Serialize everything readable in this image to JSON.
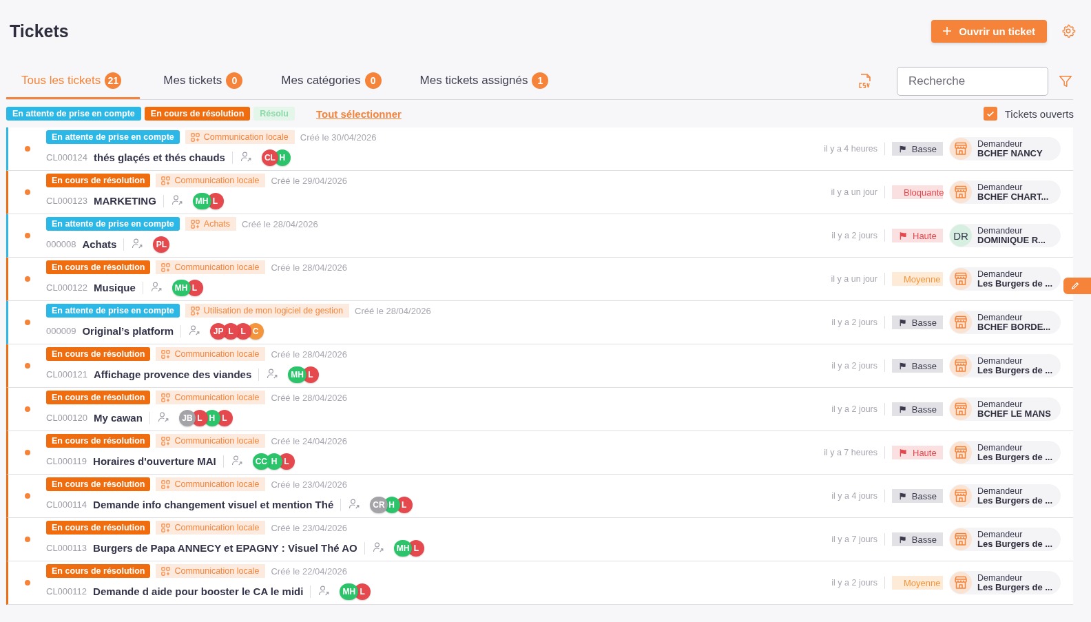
{
  "page": {
    "title": "Tickets",
    "new_button": "Ouvrir un ticket"
  },
  "tabs": [
    {
      "label": "Tous les tickets",
      "count": "21",
      "selected": true
    },
    {
      "label": "Mes tickets",
      "count": "0",
      "selected": false
    },
    {
      "label": "Mes catégories",
      "count": "0",
      "selected": false
    },
    {
      "label": "Mes tickets assignés",
      "count": "1",
      "selected": false
    }
  ],
  "search": {
    "placeholder": "Recherche"
  },
  "status_filters": [
    {
      "kind": "waiting",
      "label": "En attente de prise en compte",
      "selected": true
    },
    {
      "kind": "progress",
      "label": "En cours de résolution",
      "selected": true
    },
    {
      "kind": "resolved",
      "label": "Résolu",
      "selected": false
    }
  ],
  "select_all": "Tout sélectionner",
  "open_only": {
    "label": "Tickets ouverts",
    "checked": true
  },
  "tickets": [
    {
      "status": {
        "kind": "waiting",
        "label": "En attente de prise en compte"
      },
      "category": "Communication locale",
      "created": "Créé le 30/04/2026",
      "id": "CL000124",
      "title": "thés glaçés et thés chauds",
      "assignees": [
        {
          "initials": "CL",
          "color": "#e5484d"
        },
        {
          "initials": "H",
          "color": "#2bc46b"
        }
      ],
      "time": "il y a 4 heures",
      "priority": {
        "kind": "low",
        "label": "Basse"
      },
      "requester": {
        "kind": "store",
        "caption": "Demandeur",
        "name": "BCHEF NANCY"
      }
    },
    {
      "status": {
        "kind": "progress",
        "label": "En cours de résolution"
      },
      "category": "Communication locale",
      "created": "Créé le 29/04/2026",
      "id": "CL000123",
      "title": "MARKETING",
      "assignees": [
        {
          "initials": "MH",
          "color": "#2bc46b"
        },
        {
          "initials": "L",
          "color": "#e5484d"
        }
      ],
      "time": "il y a un jour",
      "priority": {
        "kind": "blocking",
        "label": "Bloquante"
      },
      "requester": {
        "kind": "store",
        "caption": "Demandeur",
        "name": "BCHEF CHART..."
      }
    },
    {
      "status": {
        "kind": "waiting",
        "label": "En attente de prise en compte"
      },
      "category": "Achats",
      "created": "Créé le 28/04/2026",
      "id": "000008",
      "title": "Achats",
      "assignees": [
        {
          "initials": "PL",
          "color": "#e5484d"
        }
      ],
      "time": "il y a 2 jours",
      "priority": {
        "kind": "high",
        "label": "Haute"
      },
      "requester": {
        "kind": "initials",
        "initials": "DR",
        "caption": "Demandeur",
        "name": "DOMINIQUE R..."
      }
    },
    {
      "status": {
        "kind": "progress",
        "label": "En cours de résolution"
      },
      "category": "Communication locale",
      "created": "Créé le 28/04/2026",
      "id": "CL000122",
      "title": "Musique",
      "assignees": [
        {
          "initials": "MH",
          "color": "#2bc46b"
        },
        {
          "initials": "L",
          "color": "#e5484d"
        }
      ],
      "time": "il y a un jour",
      "priority": {
        "kind": "medium",
        "label": "Moyenne"
      },
      "requester": {
        "kind": "store",
        "caption": "Demandeur",
        "name": "Les Burgers de ..."
      }
    },
    {
      "status": {
        "kind": "waiting",
        "label": "En attente de prise en compte"
      },
      "category": "Utilisation de mon logiciel de gestion",
      "created": "Créé le 28/04/2026",
      "id": "000009",
      "title": "Original’s platform",
      "assignees": [
        {
          "initials": "JP",
          "color": "#e5484d"
        },
        {
          "initials": "L",
          "color": "#e5484d"
        },
        {
          "initials": "L",
          "color": "#e5484d"
        },
        {
          "initials": "C",
          "color": "#f5953b"
        }
      ],
      "time": "il y a 2 jours",
      "priority": {
        "kind": "low",
        "label": "Basse"
      },
      "requester": {
        "kind": "store",
        "caption": "Demandeur",
        "name": "BCHEF BORDE..."
      }
    },
    {
      "status": {
        "kind": "progress",
        "label": "En cours de résolution"
      },
      "category": "Communication locale",
      "created": "Créé le 28/04/2026",
      "id": "CL000121",
      "title": "Affichage provence des viandes",
      "assignees": [
        {
          "initials": "MH",
          "color": "#2bc46b"
        },
        {
          "initials": "L",
          "color": "#e5484d"
        }
      ],
      "time": "il y a 2 jours",
      "priority": {
        "kind": "low",
        "label": "Basse"
      },
      "requester": {
        "kind": "store",
        "caption": "Demandeur",
        "name": "Les Burgers de ..."
      }
    },
    {
      "status": {
        "kind": "progress",
        "label": "En cours de résolution"
      },
      "category": "Communication locale",
      "created": "Créé le 28/04/2026",
      "id": "CL000120",
      "title": "My cawan",
      "assignees": [
        {
          "initials": "JB",
          "color": "#a3a3a8"
        },
        {
          "initials": "L",
          "color": "#e5484d"
        },
        {
          "initials": "H",
          "color": "#2bc46b"
        },
        {
          "initials": "L",
          "color": "#e5484d"
        }
      ],
      "time": "il y a 2 jours",
      "priority": {
        "kind": "low",
        "label": "Basse"
      },
      "requester": {
        "kind": "store",
        "caption": "Demandeur",
        "name": "BCHEF LE MANS"
      }
    },
    {
      "status": {
        "kind": "progress",
        "label": "En cours de résolution"
      },
      "category": "Communication locale",
      "created": "Créé le 24/04/2026",
      "id": "CL000119",
      "title": "Horaires d'ouverture MAI",
      "assignees": [
        {
          "initials": "CC",
          "color": "#2bc46b"
        },
        {
          "initials": "H",
          "color": "#2bc46b"
        },
        {
          "initials": "L",
          "color": "#e5484d"
        }
      ],
      "time": "il y a 7 heures",
      "priority": {
        "kind": "high",
        "label": "Haute"
      },
      "requester": {
        "kind": "store",
        "caption": "Demandeur",
        "name": "Les Burgers de ..."
      }
    },
    {
      "status": {
        "kind": "progress",
        "label": "En cours de résolution"
      },
      "category": "Communication locale",
      "created": "Créé le 23/04/2026",
      "id": "CL000114",
      "title": "Demande info changement visuel et mention Thé",
      "assignees": [
        {
          "initials": "CR",
          "color": "#a3a3a8"
        },
        {
          "initials": "H",
          "color": "#2bc46b"
        },
        {
          "initials": "L",
          "color": "#e5484d"
        }
      ],
      "time": "il y a 4 jours",
      "priority": {
        "kind": "low",
        "label": "Basse"
      },
      "requester": {
        "kind": "store",
        "caption": "Demandeur",
        "name": "Les Burgers de ..."
      }
    },
    {
      "status": {
        "kind": "progress",
        "label": "En cours de résolution"
      },
      "category": "Communication locale",
      "created": "Créé le 23/04/2026",
      "id": "CL000113",
      "title": "Burgers de Papa ANNECY et EPAGNY : Visuel Thé AO",
      "assignees": [
        {
          "initials": "MH",
          "color": "#2bc46b"
        },
        {
          "initials": "L",
          "color": "#e5484d"
        }
      ],
      "time": "il y a 7 jours",
      "priority": {
        "kind": "low",
        "label": "Basse"
      },
      "requester": {
        "kind": "store",
        "caption": "Demandeur",
        "name": "Les Burgers de ..."
      }
    },
    {
      "status": {
        "kind": "progress",
        "label": "En cours de résolution"
      },
      "category": "Communication locale",
      "created": "Créé le 22/04/2026",
      "id": "CL000112",
      "title": "Demande d aide pour booster le CA le midi",
      "assignees": [
        {
          "initials": "MH",
          "color": "#2bc46b"
        },
        {
          "initials": "L",
          "color": "#e5484d"
        }
      ],
      "time": "il y a 2 jours",
      "priority": {
        "kind": "medium",
        "label": "Moyenne"
      },
      "requester": {
        "kind": "store",
        "caption": "Demandeur",
        "name": "Les Burgers de ..."
      }
    }
  ]
}
